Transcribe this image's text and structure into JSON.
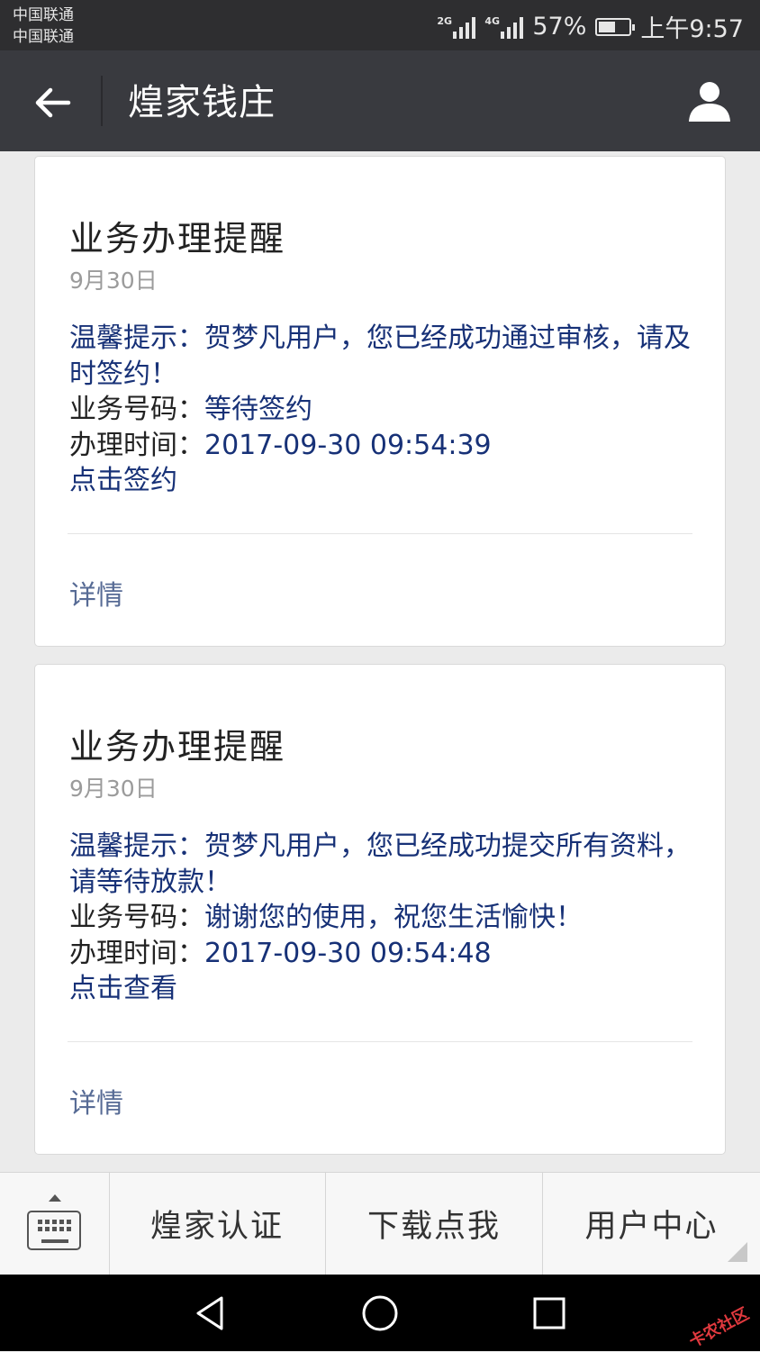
{
  "status": {
    "carrier1": "中国联通",
    "carrier2": "中国联通",
    "net1": "2G",
    "net2": "4G",
    "battery": "57%",
    "battery_level": 0.57,
    "time": "上午9:57"
  },
  "nav": {
    "title": "煌家钱庄",
    "back_icon": "arrow-left-icon",
    "user_icon": "user-icon"
  },
  "cards": [
    {
      "title": "业务办理提醒",
      "date": "9月30日",
      "tip_label": "温馨提示：",
      "tip_text": "贺梦凡用户，您已经成功通过审核，请及时签约！",
      "biz_label": "业务号码：",
      "biz_value": "等待签约",
      "time_label": "办理时间：",
      "time_value": "2017-09-30 09:54:39",
      "action": "点击签约",
      "detail": "详情"
    },
    {
      "title": "业务办理提醒",
      "date": "9月30日",
      "tip_label": "温馨提示：",
      "tip_text": "贺梦凡用户，您已经成功提交所有资料，请等待放款！",
      "biz_label": "业务号码：",
      "biz_value": "谢谢您的使用，祝您生活愉快！",
      "time_label": "办理时间：",
      "time_value": "2017-09-30 09:54:48",
      "action": "点击查看",
      "detail": "详情"
    }
  ],
  "menu": {
    "keyboard_icon": "keyboard-icon",
    "items": [
      "煌家认证",
      "下载点我",
      "用户中心"
    ]
  },
  "sysnav": {
    "back_icon": "triangle-back-icon",
    "home_icon": "circle-home-icon",
    "recents_icon": "square-recents-icon"
  },
  "watermark": "卡农社区",
  "colors": {
    "navbar": "#393a3f",
    "statusbar": "#2e2e30",
    "value_blue": "#173177",
    "detail_link": "#576b95"
  }
}
